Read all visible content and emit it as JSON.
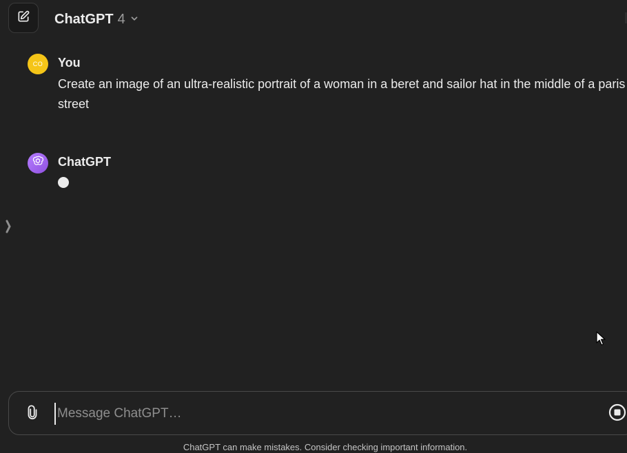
{
  "header": {
    "model_name": "ChatGPT",
    "model_version": "4",
    "new_chat_icon": "edit-icon",
    "dropdown_icon": "chevron-down-icon"
  },
  "conversation": {
    "user_message": {
      "author": "You",
      "avatar_initials": "CO",
      "avatar_color": "#f5c518",
      "text": "Create an image of an ultra-realistic portrait of a woman in a beret and sailor hat in the middle of a paris street"
    },
    "assistant_message": {
      "author": "ChatGPT",
      "avatar_icon": "openai-logo-icon",
      "avatar_color": "#ab68ff",
      "status_indicator": "typing-dot"
    }
  },
  "composer": {
    "placeholder": "Message ChatGPT…",
    "value": "",
    "attach_icon": "paperclip-icon",
    "stop_icon": "stop-icon"
  },
  "footer": {
    "disclaimer": "ChatGPT can make mistakes. Consider checking important information."
  },
  "colors": {
    "background": "#212121",
    "text": "#ececec",
    "muted": "#8e8e8e"
  }
}
